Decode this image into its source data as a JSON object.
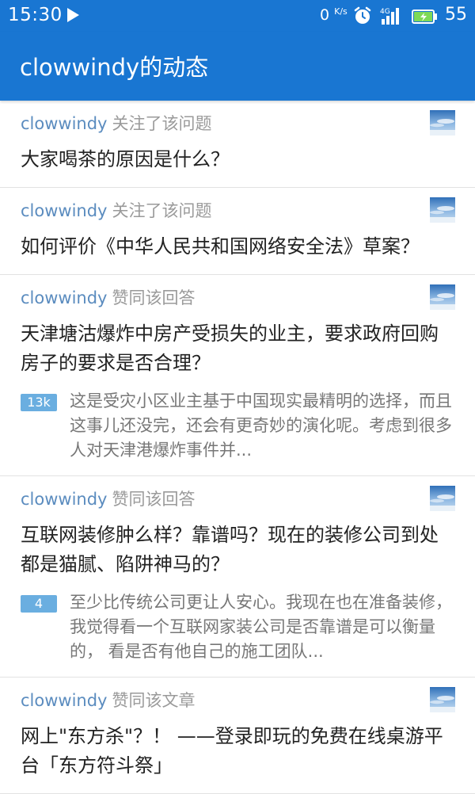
{
  "status_bar": {
    "time": "15:30",
    "net_speed_value": "0",
    "net_speed_unit": "K/s",
    "network_type": "4G",
    "battery_level": "55",
    "icons": [
      "play-icon",
      "alarm-icon",
      "signal-icon",
      "battery-icon"
    ]
  },
  "app_bar": {
    "title": "clowwindy的动态"
  },
  "colors": {
    "primary": "#1976d2",
    "username": "#5b8cbf",
    "action_text": "#9a9a9a",
    "title_text": "#222222",
    "excerpt_text": "#777777",
    "badge": "#6aaee0",
    "divider": "#e2e2e2"
  },
  "feed": {
    "items": [
      {
        "user": "clowwindy",
        "action": "关注了该问题",
        "title": "大家喝茶的原因是什么？"
      },
      {
        "user": "clowwindy",
        "action": "关注了该问题",
        "title": "如何评价《中华人民共和国网络安全法》草案？"
      },
      {
        "user": "clowwindy",
        "action": "赞同该回答",
        "title": "天津塘沽爆炸中房产受损失的业主，要求政府回购房子的要求是否合理？",
        "votes": "13k",
        "excerpt": "这是受灾小区业主基于中国现实最精明的选择，而且这事儿还没完，还会有更奇妙的演化呢。考虑到很多人对天津港爆炸事件并..."
      },
      {
        "user": "clowwindy",
        "action": "赞同该回答",
        "title": "互联网装修肿么样？靠谱吗？现在的装修公司到处都是猫腻、陷阱神马的？",
        "votes": "4",
        "excerpt": "至少比传统公司更让人安心。我现在也在准备装修，我觉得看一个互联网家装公司是否靠谱是可以衡量的， 看是否有他自己的施工团队..."
      },
      {
        "user": "clowwindy",
        "action": "赞同该文章",
        "title": "网上\"东方杀\"？！ ——登录即玩的免费在线桌游平台「东方符斗祭」"
      }
    ]
  }
}
